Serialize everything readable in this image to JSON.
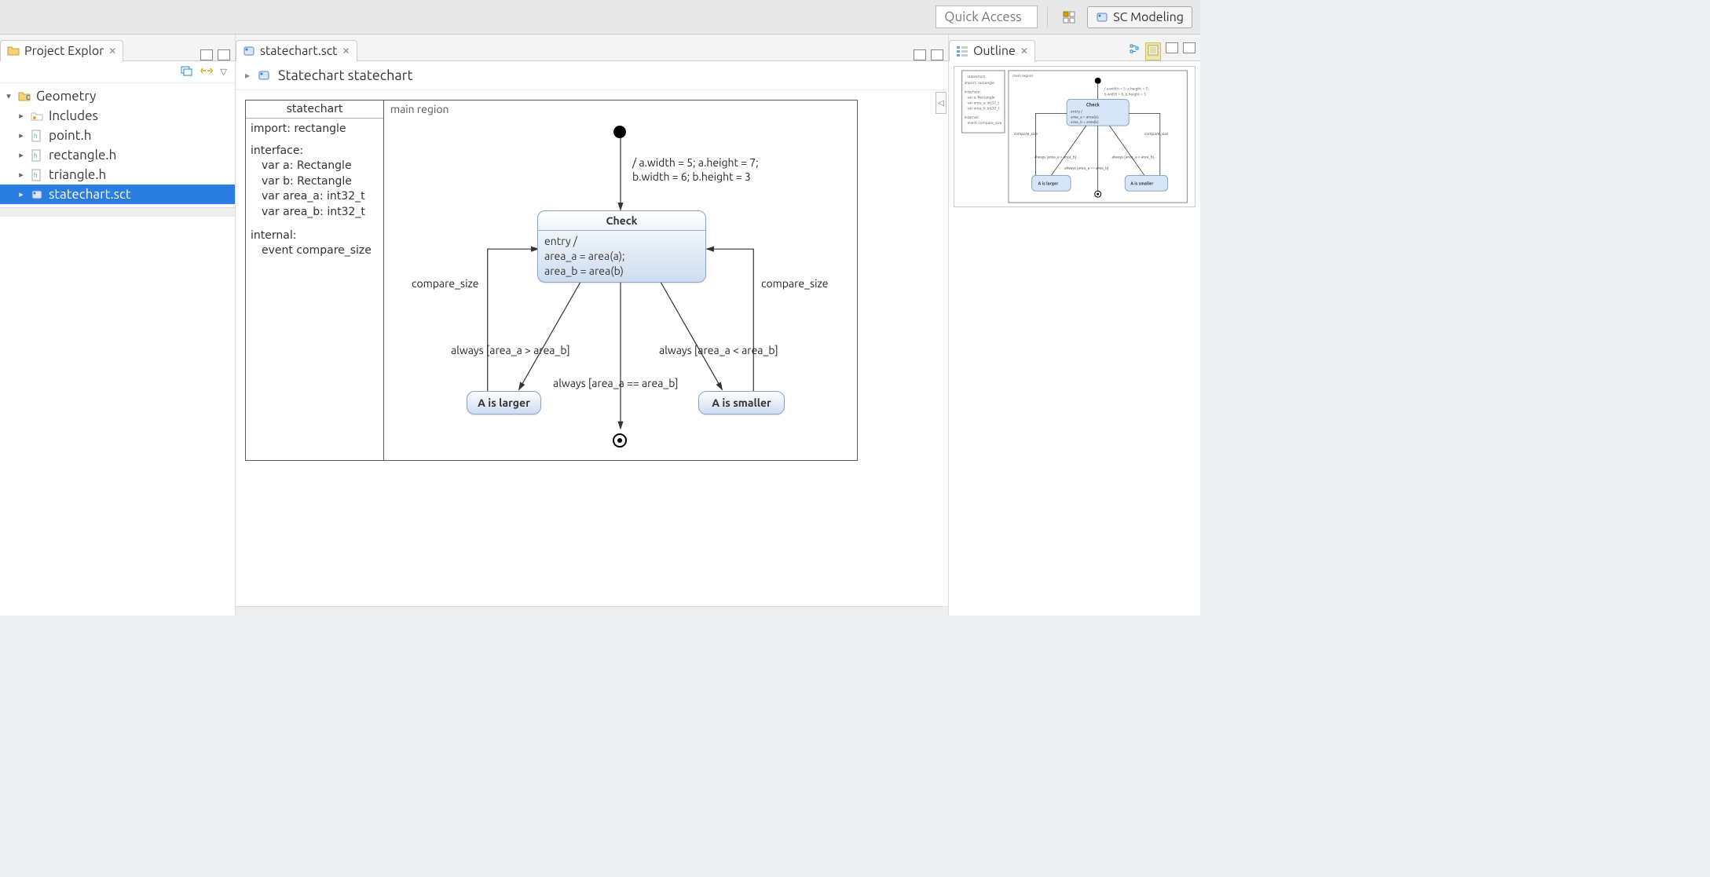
{
  "toolbar": {
    "quick_access_placeholder": "Quick Access",
    "perspective_label": "SC Modeling"
  },
  "project_explorer": {
    "title": "Project Explor",
    "root": "Geometry",
    "items": [
      {
        "name": "Includes",
        "icon": "includes"
      },
      {
        "name": "point.h",
        "icon": "header"
      },
      {
        "name": "rectangle.h",
        "icon": "header"
      },
      {
        "name": "triangle.h",
        "icon": "header"
      },
      {
        "name": "statechart.sct",
        "icon": "statechart",
        "selected": true
      }
    ]
  },
  "editor": {
    "tab_label": "statechart.sct",
    "breadcrumb": "Statechart statechart",
    "definition": {
      "title": "statechart",
      "import_line": "import: rectangle",
      "interface_header": "interface:",
      "interface_lines": [
        "var a: Rectangle",
        "var b: Rectangle",
        "var area_a: int32_t",
        "var area_b: int32_t"
      ],
      "internal_header": "internal:",
      "internal_lines": [
        "event compare_size"
      ]
    },
    "region_title": "main region",
    "init_transition_label": "/ a.width = 5; a.height = 7;\nb.width = 6; b.height = 3",
    "states": {
      "check": {
        "title": "Check",
        "body": "entry /\narea_a = area(a);\narea_b = area(b)"
      },
      "a_larger": "A is larger",
      "a_smaller": "A is smaller"
    },
    "transitions": {
      "compare_left": "compare_size",
      "compare_right": "compare_size",
      "a_gt_b": "always [area_a > area_b]",
      "a_lt_b": "always [area_a < area_b]",
      "a_eq_b": "always [area_a == area_b]"
    }
  },
  "outline": {
    "title": "Outline"
  }
}
